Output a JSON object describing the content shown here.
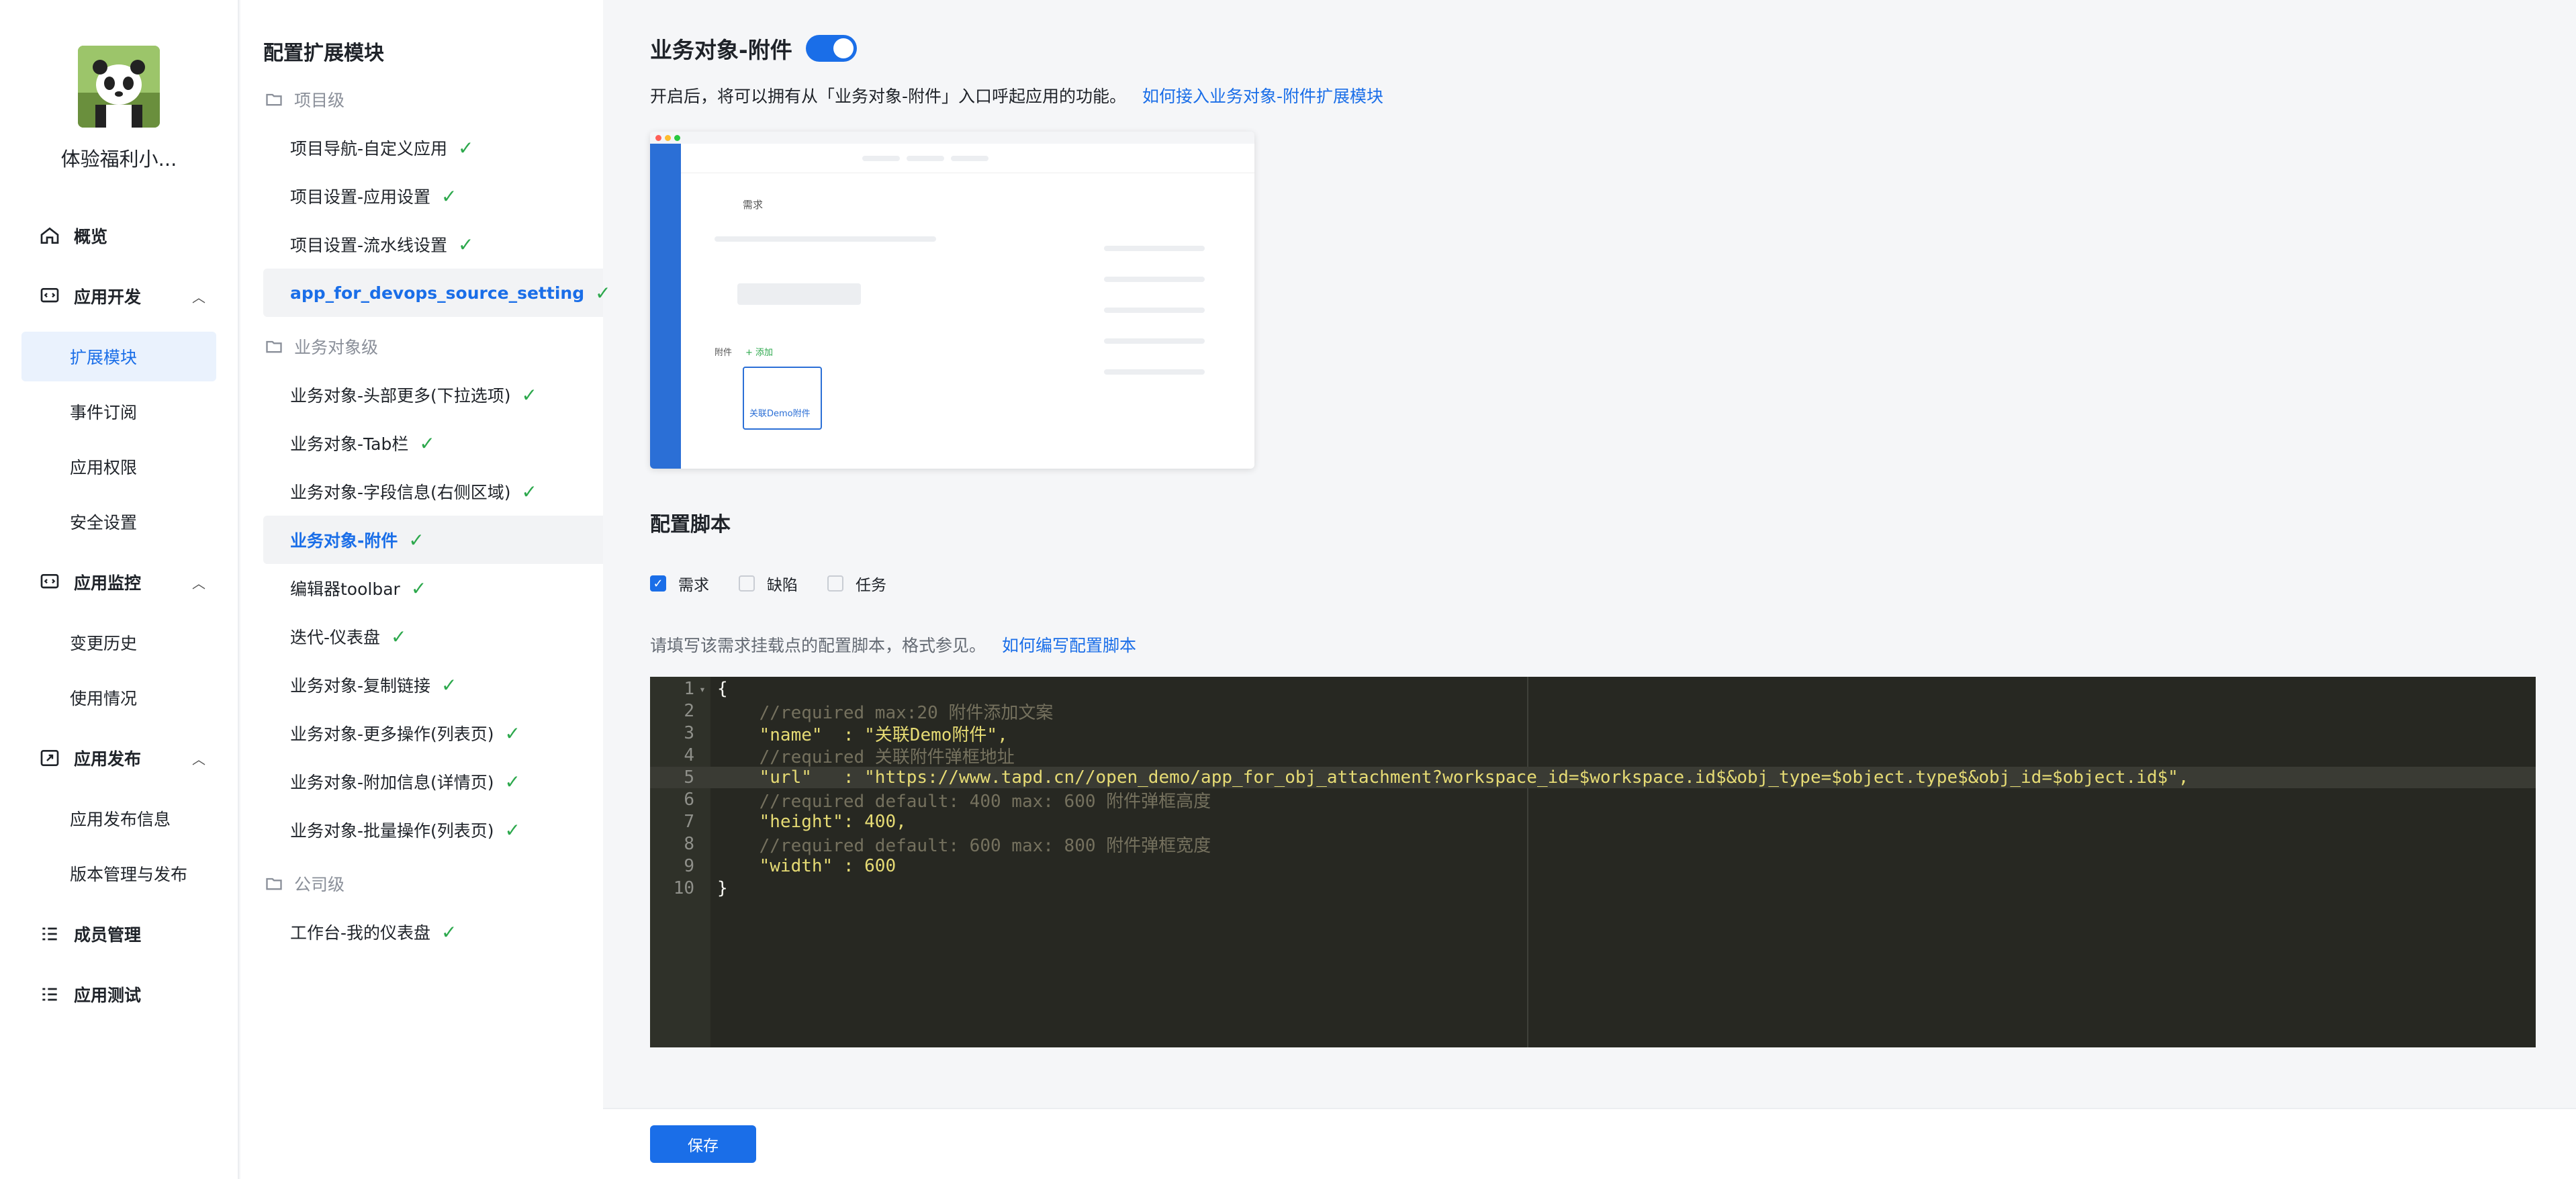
{
  "app": {
    "name": "体验福利小..."
  },
  "nav": {
    "overview": "概览",
    "dev": {
      "label": "应用开发",
      "items": [
        "扩展模块",
        "事件订阅",
        "应用权限",
        "安全设置"
      ]
    },
    "monitor": {
      "label": "应用监控",
      "items": [
        "变更历史",
        "使用情况"
      ]
    },
    "publish": {
      "label": "应用发布",
      "items": [
        "应用发布信息",
        "版本管理与发布"
      ]
    },
    "members": "成员管理",
    "testing": "应用测试"
  },
  "modules": {
    "title": "配置扩展模块",
    "project_group": "项目级",
    "project_items": [
      "项目导航-自定义应用",
      "项目设置-应用设置",
      "项目设置-流水线设置",
      "app_for_devops_source_setting"
    ],
    "object_group": "业务对象级",
    "object_items": [
      "业务对象-头部更多(下拉选项)",
      "业务对象-Tab栏",
      "业务对象-字段信息(右侧区域)",
      "业务对象-附件",
      "编辑器toolbar",
      "迭代-仪表盘",
      "业务对象-复制链接",
      "业务对象-更多操作(列表页)",
      "业务对象-附加信息(详情页)",
      "业务对象-批量操作(列表页)"
    ],
    "company_group": "公司级",
    "company_items": [
      "工作台-我的仪表盘"
    ],
    "check_mark": "✓"
  },
  "main": {
    "title": "业务对象-附件",
    "toggle_on": true,
    "desc": "开启后，将可以拥有从「业务对象-附件」入口呼起应用的功能。",
    "desc_link": "如何接入业务对象-附件扩展模块",
    "preview": {
      "header": "需求",
      "attach_label": "附件",
      "add_label": "+ 添加",
      "card_label": "关联Demo附件"
    },
    "script_title": "配置脚本",
    "types": [
      {
        "label": "需求",
        "checked": true
      },
      {
        "label": "缺陷",
        "checked": false
      },
      {
        "label": "任务",
        "checked": false
      }
    ],
    "hint": "请填写该需求挂载点的配置脚本，格式参见。",
    "hint_link": "如何编写配置脚本",
    "code_lines": [
      "{",
      "    //required max:20 附件添加文案",
      "    \"name\"  : \"关联Demo附件\",",
      "    //required 关联附件弹框地址",
      "    \"url\"   : \"https://www.tapd.cn//open_demo/app_for_obj_attachment?workspace_id=$workspace.id$&obj_type=$object.type$&obj_id=$object.id$\",",
      "    //required default: 400 max: 600 附件弹框高度",
      "    \"height\": 400,",
      "    //required default: 600 max: 800 附件弹框宽度",
      "    \"width\" : 600",
      "}"
    ],
    "save_label": "保存"
  },
  "colors": {
    "accent": "#1a6ee8",
    "check": "#2ca84c",
    "editor_bg": "#272822"
  }
}
